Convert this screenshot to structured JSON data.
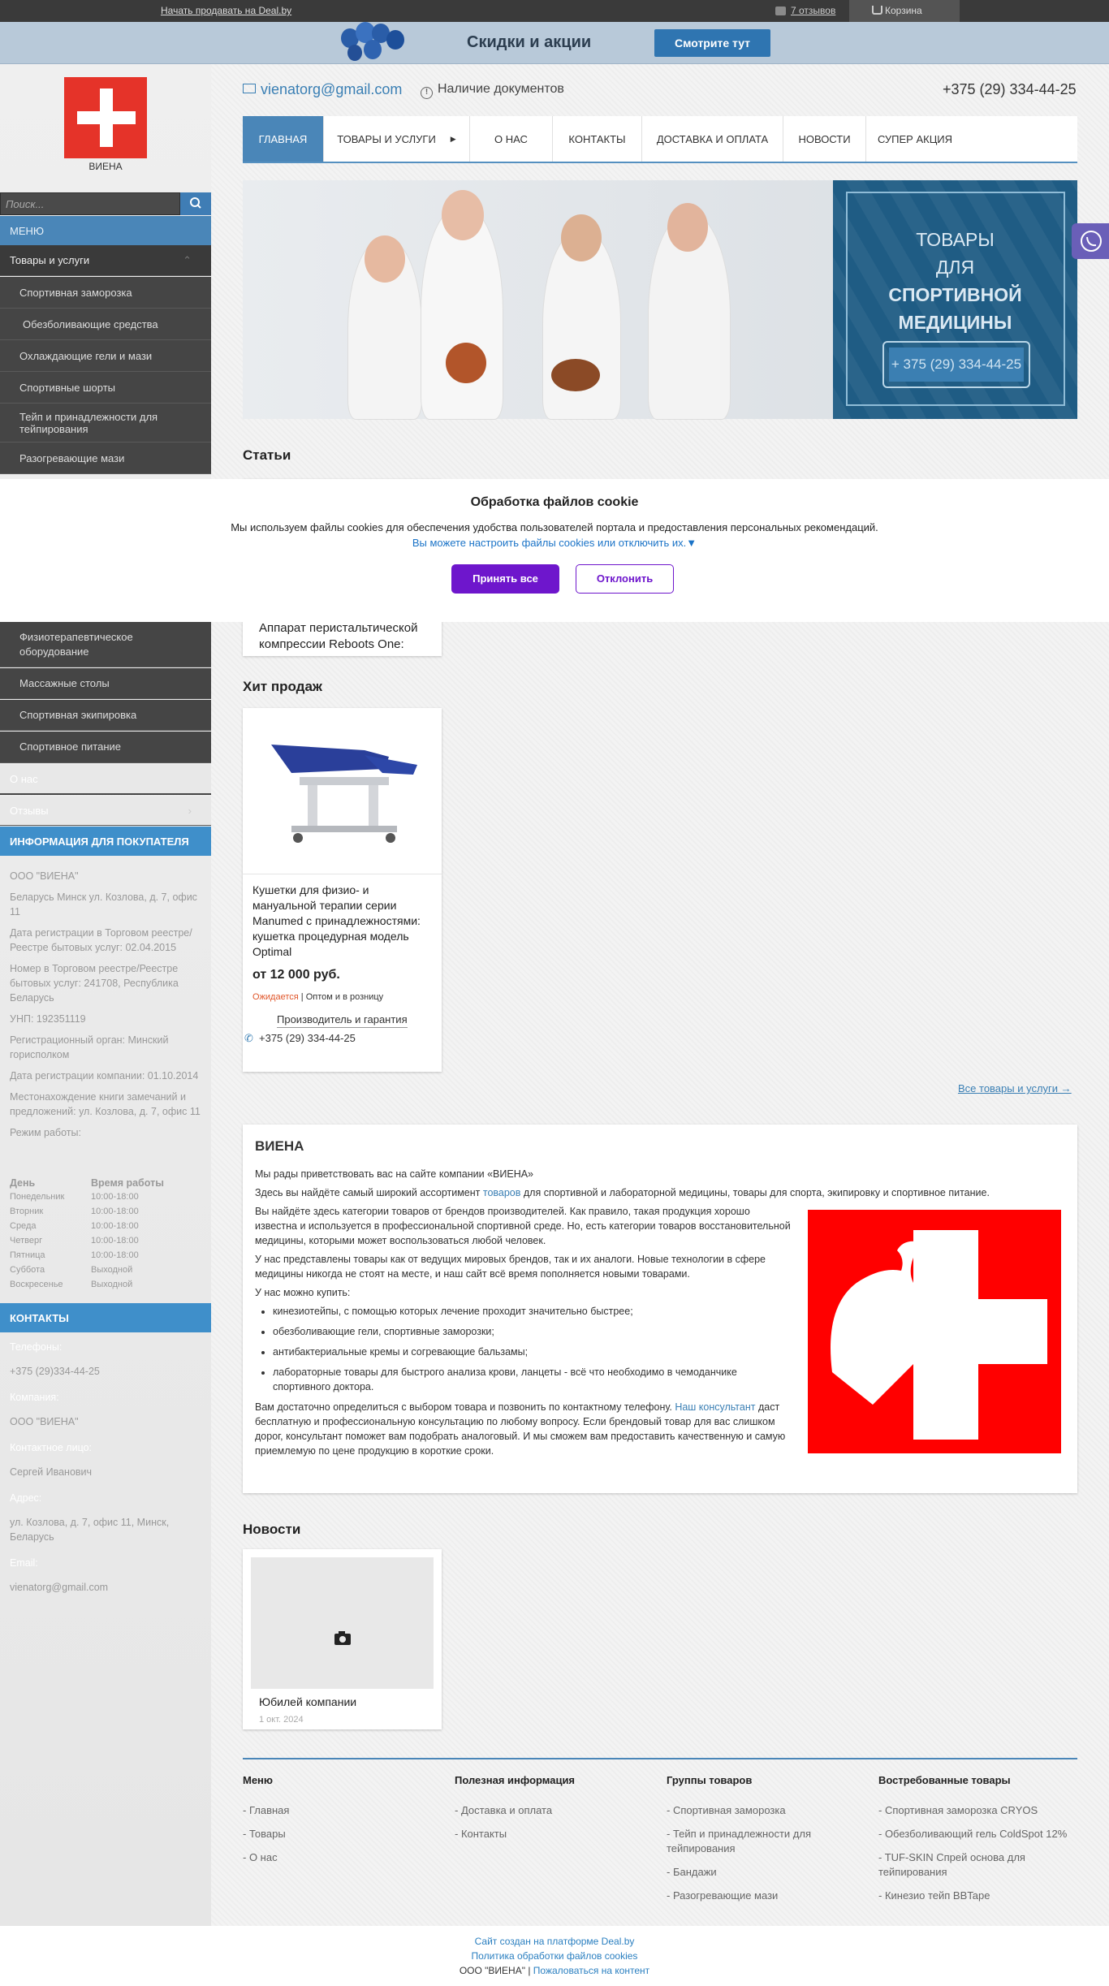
{
  "topbar": {
    "sell_link": "Начать продавать на Deal.by",
    "reviews": "7 отзывов",
    "cart": "Корзина"
  },
  "promo": {
    "title": "Скидки и акции",
    "button": "Смотрите тут"
  },
  "company": {
    "name": "ВИЕНА",
    "email": "vienatorg@gmail.com",
    "docs": "Наличие документов",
    "phone": "+375 (29) 334-44-25"
  },
  "search": {
    "placeholder": "Поиск..."
  },
  "nav": [
    "ГЛАВНАЯ",
    "ТОВАРЫ И УСЛУГИ",
    "О НАС",
    "КОНТАКТЫ",
    "ДОСТАВКА И ОПЛАТА",
    "НОВОСТИ",
    "СУПЕР АКЦИЯ"
  ],
  "sidebar": {
    "menu_label": "МЕНЮ",
    "goods_label": "Товары и услуги",
    "categories_top": [
      "Спортивная заморозка",
      "Обезболивающие средства",
      "Охлаждающие гели и мази",
      "Спортивные шорты",
      "Тейп и принадлежности для тейпирования",
      "Разогревающие мази"
    ],
    "categories_bottom": [
      "Физиотерапевтическое оборудование",
      "Массажные столы",
      "Спортивная экипировка",
      "Спортивное питание"
    ],
    "about_label": "О нас",
    "reviews_label": "Отзывы",
    "buyer_info_title": "ИНФОРМАЦИЯ ДЛЯ ПОКУПАТЕЛЯ",
    "buyer_info": [
      "ООО \"ВИЕНА\"",
      "Беларусь Минск ул. Козлова, д. 7, офис 11",
      "Дата регистрации в Торговом реестре/Реестре бытовых услуг: 02.04.2015",
      "Номер в Торговом реестре/Реестре бытовых услуг: 241708, Республика Беларусь",
      "УНП: 192351119",
      "Регистрационный орган: Минский горисполком",
      "Дата регистрации компании: 01.10.2014",
      "Местонахождение книги замечаний и предложений: ул. Козлова, д. 7, офис 11",
      "Режим работы:"
    ],
    "schedule_header": [
      "День",
      "Время работы"
    ],
    "schedule": [
      [
        "Понедельник",
        "10:00-18:00"
      ],
      [
        "Вторник",
        "10:00-18:00"
      ],
      [
        "Среда",
        "10:00-18:00"
      ],
      [
        "Четверг",
        "10:00-18:00"
      ],
      [
        "Пятница",
        "10:00-18:00"
      ],
      [
        "Суббота",
        "Выходной"
      ],
      [
        "Воскресенье",
        "Выходной"
      ]
    ],
    "contacts_title": "КОНТАКТЫ",
    "contacts": [
      {
        "label": "Телефоны:",
        "value": "+375 (29)334-44-25"
      },
      {
        "label": "Компания:",
        "value": "ООО \"ВИЕНА\""
      },
      {
        "label": "Контактное лицо:",
        "value": "Сергей Иванович"
      },
      {
        "label": "Адрес:",
        "value": "ул. Козлова, д. 7, офис 11, Минск, Беларусь"
      },
      {
        "label": "Email:",
        "value": "vienatorg@gmail.com"
      }
    ]
  },
  "banner": {
    "line1": "ТОВАРЫ",
    "line2": "ДЛЯ",
    "line3": "СПОРТИВНОЙ МЕДИЦИНЫ",
    "phone": "+ 375 (29) 334-44-25"
  },
  "articles": {
    "title": "Статьи",
    "card_text": "Аппарат перистальтической компрессии Reboots One:"
  },
  "cookie": {
    "title": "Обработка файлов cookie",
    "text": "Мы используем файлы cookies для обеспечения удобства пользователей портала и предоставления персональных рекомендаций.",
    "link": "Вы можете настроить файлы cookies или отключить их.▼",
    "accept": "Принять все",
    "decline": "Отклонить"
  },
  "hits": {
    "title": "Хит продаж",
    "name": "Кушетки для физио- и мануальной терапии серии Manumed с принадлежностями: кушетка процедурная модель Optimal",
    "price": "от 12 000 руб.",
    "status": "Ожидается",
    "sale_type": "Оптом и в розницу",
    "maker": "Производитель и гарантия",
    "phone": "+375 (29) 334-44-25",
    "all_link": "Все товары и услуги →"
  },
  "about": {
    "title": "ВИЕНА",
    "p1": "Мы рады приветствовать вас на сайте компании «ВИЕНА»",
    "p2_a": "Здесь вы найдёте самый широкий ассортимент ",
    "p2_link": "товаров",
    "p2_b": " для спортивной и лабораторной медицины, товары для спорта, экипировку и спортивное питание.",
    "p3": "Вы найдёте здесь категории товаров от брендов производителей. Как правило, такая продукция хорошо известна и используется в профессиональной спортивной среде. Но, есть категории товаров восстановительной медицины, которыми может воспользоваться любой человек.",
    "p4": "У нас представлены товары как от ведущих мировых брендов, так и их аналоги. Новые технологии в сфере медицины никогда не стоят на месте, и наш сайт всё время пополняется новыми товарами.",
    "p5": "У нас можно купить:",
    "list": [
      "кинезиотейпы, с помощью которых лечение проходит значительно быстрее;",
      "обезболивающие гели, спортивные заморозки;",
      "антибактериальные кремы и согревающие бальзамы;",
      "лабораторные товары для быстрого анализа крови, ланцеты - всё что необходимо в чемоданчике спортивного доктора."
    ],
    "p6_a": "Вам достаточно определиться с выбором товара и позвонить по контактному телефону. ",
    "p6_link": "Наш консультант",
    "p6_b": " даст бесплатную и профессиональную консультацию по любому вопросу. Если брендовый товар для вас слишком дорог, консультант поможет вам подобрать аналоговый. И мы сможем вам предоставить качественную и самую приемлемую по цене продукцию в короткие сроки."
  },
  "news": {
    "title": "Новости",
    "name": "Юбилей компании",
    "date": "1 окт. 2024"
  },
  "footer": {
    "cols": [
      {
        "title": "Меню",
        "links": [
          "- Главная",
          "- Товары",
          "- О нас"
        ]
      },
      {
        "title": "Полезная информация",
        "links": [
          "- Доставка и оплата",
          "- Контакты"
        ]
      },
      {
        "title": "Группы товаров",
        "links": [
          "- Спортивная заморозка",
          "- Тейп и принадлежности для тейпирования",
          "- Бандажи",
          "- Разогревающие мази"
        ]
      },
      {
        "title": "Востребованные товары",
        "links": [
          "- Спортивная заморозка CRYOS",
          "- Обезболивающий гель ColdSpot 12%",
          "- TUF-SKIN Спрей основа для тейпирования",
          "- Кинезио тейп BBTape"
        ]
      }
    ],
    "platform": "Сайт создан на платформе Deal.by",
    "policy": "Политика обработки файлов cookies",
    "company": "ООО \"ВИЕНА\"",
    "sep": " | ",
    "complain": "Пожаловаться на контент"
  },
  "colors": {
    "accent": "#4a86b8",
    "logo_red": "#e53329",
    "cookie_purple": "#6e16cc"
  }
}
